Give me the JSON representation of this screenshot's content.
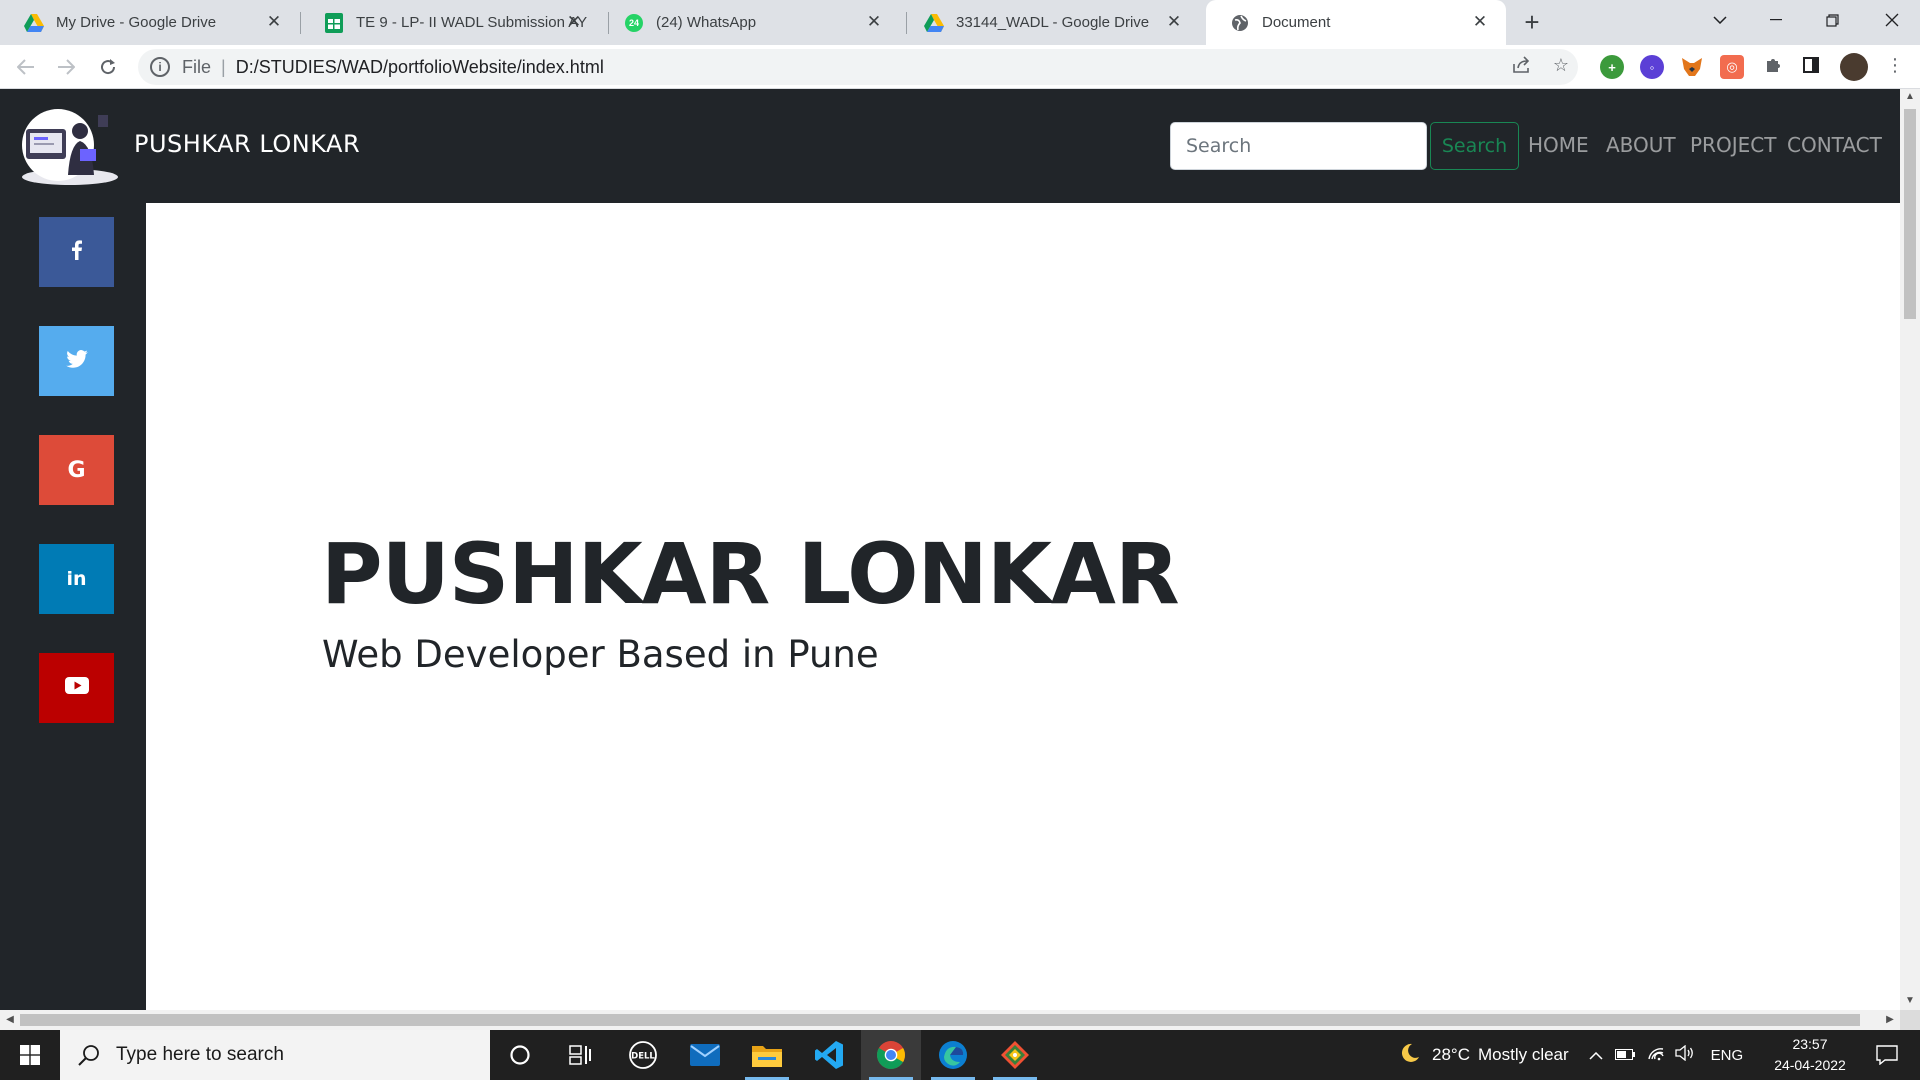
{
  "browser": {
    "tabs": [
      {
        "title": "My Drive - Google Drive",
        "icon": "google-drive-icon",
        "active": false
      },
      {
        "title": "TE 9 - LP- II WADL Submission AY",
        "icon": "google-sheets-icon",
        "active": false
      },
      {
        "title": "(24) WhatsApp",
        "icon": "whatsapp-icon",
        "active": false
      },
      {
        "title": "33144_WADL - Google Drive",
        "icon": "google-drive-icon",
        "active": false
      },
      {
        "title": "Document",
        "icon": "globe-icon",
        "active": true
      }
    ],
    "whatsapp_badge": "24",
    "address": {
      "scheme_label": "File",
      "url": "D:/STUDIES/WAD/portfolioWebsite/index.html"
    }
  },
  "page": {
    "brand_name": "PUSHKAR LONKAR",
    "search": {
      "placeholder": "Search",
      "button_label": "Search"
    },
    "nav_links": [
      "HOME",
      "ABOUT",
      "PROJECT",
      "CONTACT"
    ],
    "social_links": [
      {
        "name": "facebook",
        "icon": "facebook-icon",
        "color": "#3b5998"
      },
      {
        "name": "twitter",
        "icon": "twitter-icon",
        "color": "#55acee"
      },
      {
        "name": "google",
        "icon": "google-icon",
        "color": "#dd4b39"
      },
      {
        "name": "linkedin",
        "icon": "linkedin-icon",
        "color": "#007bb5"
      },
      {
        "name": "youtube",
        "icon": "youtube-icon",
        "color": "#bb0000"
      }
    ],
    "hero": {
      "title": "PUSHKAR LONKAR",
      "subtitle": "Web Developer Based in Pune"
    },
    "colors": {
      "navbar_bg": "#212529",
      "search_accent": "#198754",
      "page_bg": "#ffffff"
    }
  },
  "taskbar": {
    "search_placeholder": "Type here to search",
    "weather": {
      "temperature": "28°C",
      "condition": "Mostly clear"
    },
    "language": "ENG",
    "time": "23:57",
    "date": "24-04-2022",
    "apps": [
      "cortana-icon",
      "task-view-icon",
      "dell-icon",
      "mail-icon",
      "file-explorer-icon",
      "vscode-icon",
      "chrome-icon",
      "edge-icon",
      "git-icon"
    ]
  }
}
